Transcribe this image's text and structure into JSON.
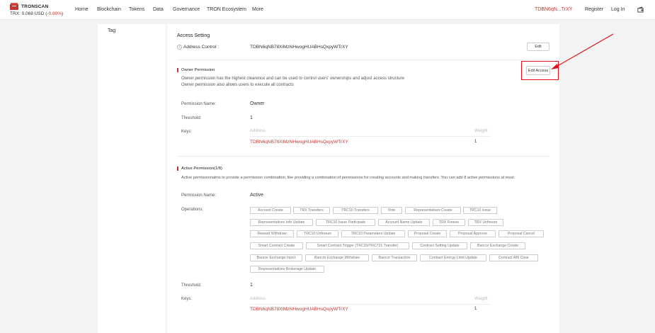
{
  "header": {
    "brand": "TRONSCAN",
    "price_prefix": "TRX: 0.068 USD (",
    "price_change": "-0.80%",
    "price_suffix": ")",
    "nav": [
      "Home",
      "Blockchain",
      "Tokens",
      "Data",
      "Governance",
      "TRON Ecosystem",
      "More"
    ],
    "account": "TDBN6qN...TrXY",
    "register": "Register",
    "login": "Log In"
  },
  "sidebar": {
    "items": [
      "Tag"
    ]
  },
  "access": {
    "title": "Access Setting",
    "address_control_label": "Address Control :",
    "address": "TDBN6qNB78XiMzNHwogHUABHsQxpyWTrXY",
    "edit_label": "Edit"
  },
  "owner": {
    "title": "Owner Permission",
    "edit_access_label": "Edit Access",
    "desc_line1": "Owner permission has the highest clearence and can be used to control users' ownerships and adjust access structure",
    "desc_line2": "Owner permission also allows users to execute all contracts",
    "name_label": "Permission Name:",
    "name_value": "Owner",
    "threshold_label": "Threshold:",
    "threshold_value": "1",
    "keys_label": "Keys:",
    "address_header": "Address",
    "weight_header": "Weight",
    "key_address": "TDBN6qNB78XiMzNHwogHUABHsQxpyWTrXY",
    "key_weight": "1"
  },
  "active": {
    "title": "Active Permission",
    "count": "(1/8)",
    "desc": "Active permissionaims to provide a permission combination, like providing a combination of permissions for creating accounts and making transfers. You can add 8 active permissions at most.",
    "name_label": "Permission Name:",
    "name_value": "Active",
    "operations_label": "Operations:",
    "operations": [
      "Account Create",
      "TRX Transfers",
      "TRC10 Transfers",
      "Vote",
      "Representatives Create",
      "TRC10 Issue",
      "Representatives Info Update",
      "TRC10 Issue Participate",
      "Account Name Update",
      "TRX Freeze",
      "TRX Unfreeze",
      "Reward Withdraw",
      "TRC10 Unfreeze",
      "TRC10 Parameters Update",
      "Proposal Create",
      "Proposal Approve",
      "Proposal Cancel",
      "Smart Contract Create",
      "Smart Contract Trigger (TRC20/TRC721 Transfer)",
      "Contract Setting Update",
      "Bancor Exchange Create",
      "Bancor Exchange Inject",
      "Bancor Exchange Withdraw",
      "Bancor Transaction",
      "Contract Energy Limit Update",
      "Contract ABI Clear",
      "Representatives Brokerage Update"
    ],
    "threshold_label": "Threshold:",
    "threshold_value": "1",
    "keys_label": "Keys:",
    "address_header": "Address",
    "weight_header": "Weight",
    "key_address": "TDBN6qNB78XiMzNHwogHUABHsQxpyWTrXY",
    "key_weight": "1"
  },
  "colors": {
    "accent": "#c23631",
    "highlight": "#e0111b"
  }
}
